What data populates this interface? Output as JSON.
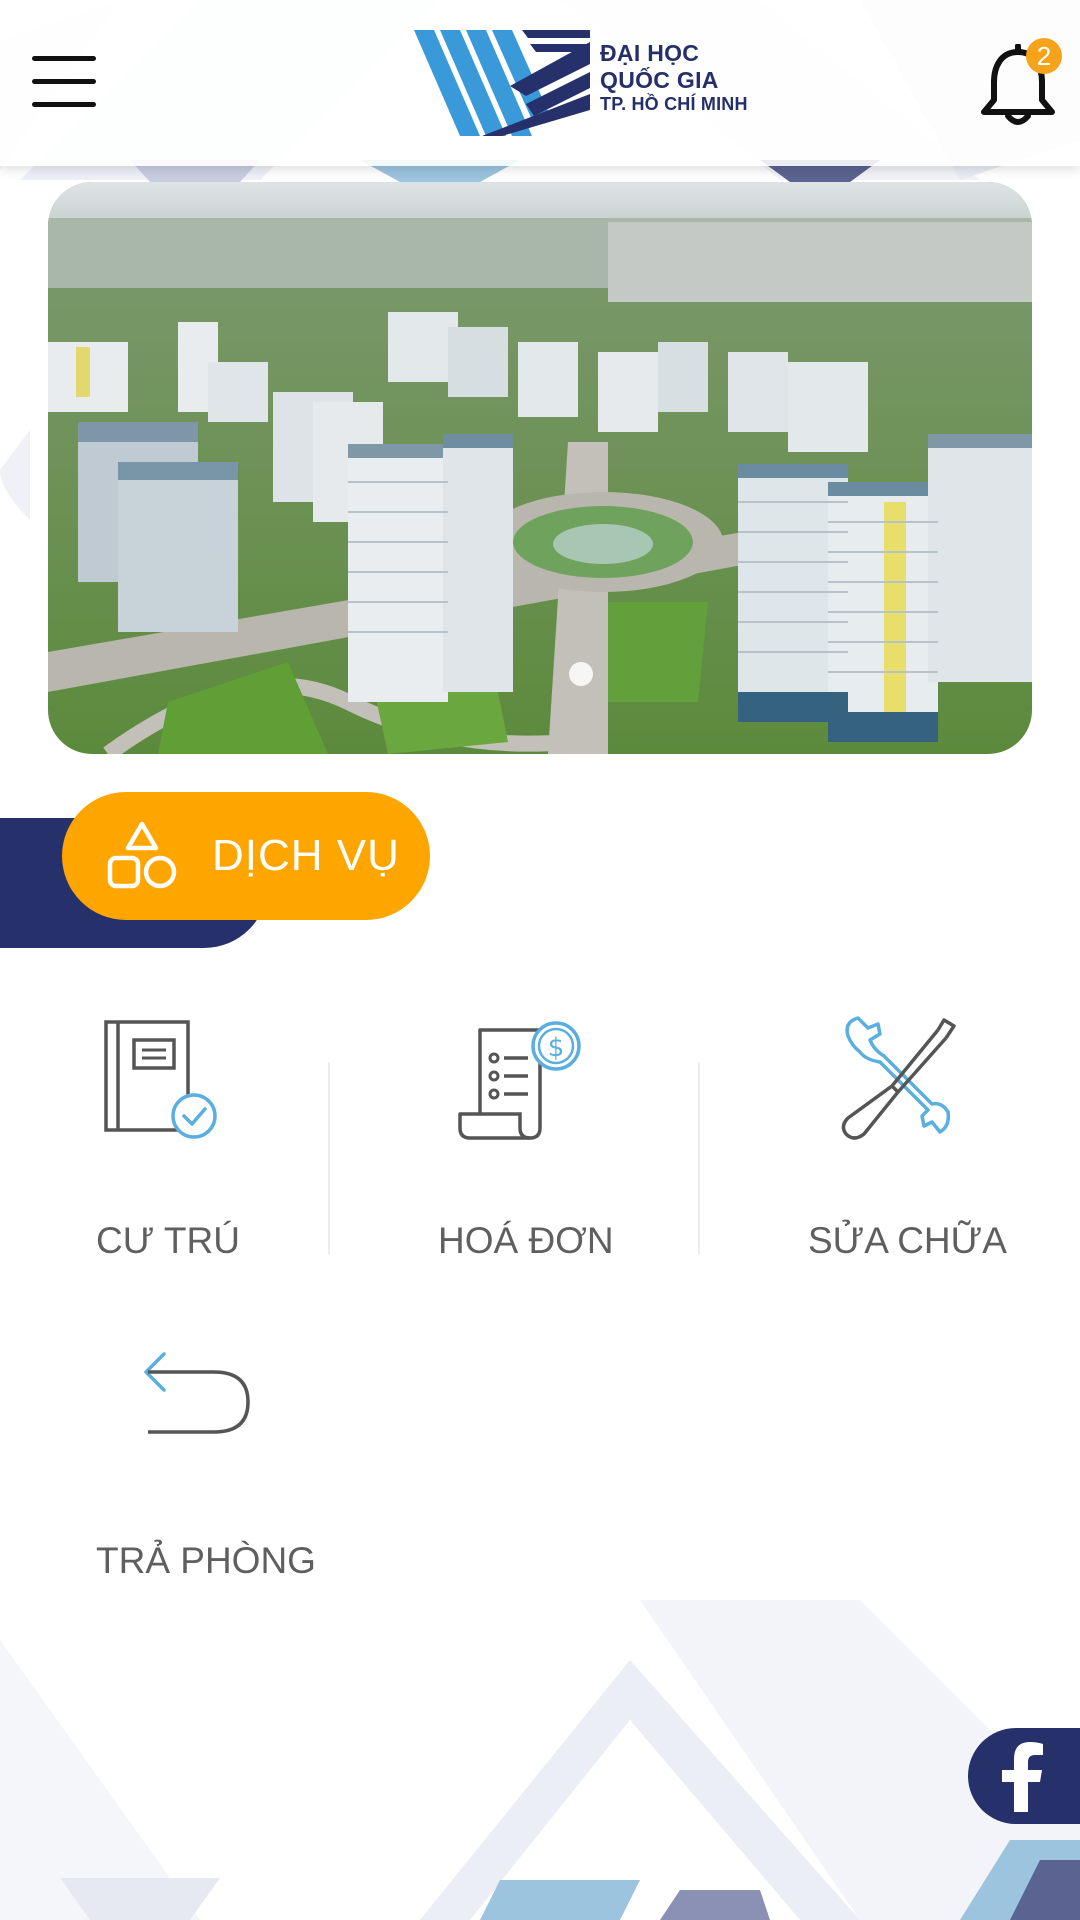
{
  "header": {
    "logo_lines": [
      "ĐẠI HỌC",
      "QUỐC GIA",
      "TP. HỒ CHÍ MINH"
    ],
    "notification_count": "2"
  },
  "banner": {
    "slides_count": 1,
    "active_slide": 1
  },
  "section": {
    "title": "DỊCH VỤ",
    "icon": "shapes-icon"
  },
  "services": [
    {
      "label": "CƯ TRÚ",
      "icon": "residence-book-icon"
    },
    {
      "label": "HOÁ ĐƠN",
      "icon": "invoice-icon"
    },
    {
      "label": "SỬA CHỮA",
      "icon": "repair-tools-icon"
    },
    {
      "label": "TRẢ PHÒNG",
      "icon": "return-arrow-icon"
    }
  ],
  "colors": {
    "navy": "#26306a",
    "orange": "#ffa500",
    "accent_blue": "#4fa3d9",
    "badge": "#f7a21b"
  },
  "social": {
    "icon": "facebook-icon"
  }
}
